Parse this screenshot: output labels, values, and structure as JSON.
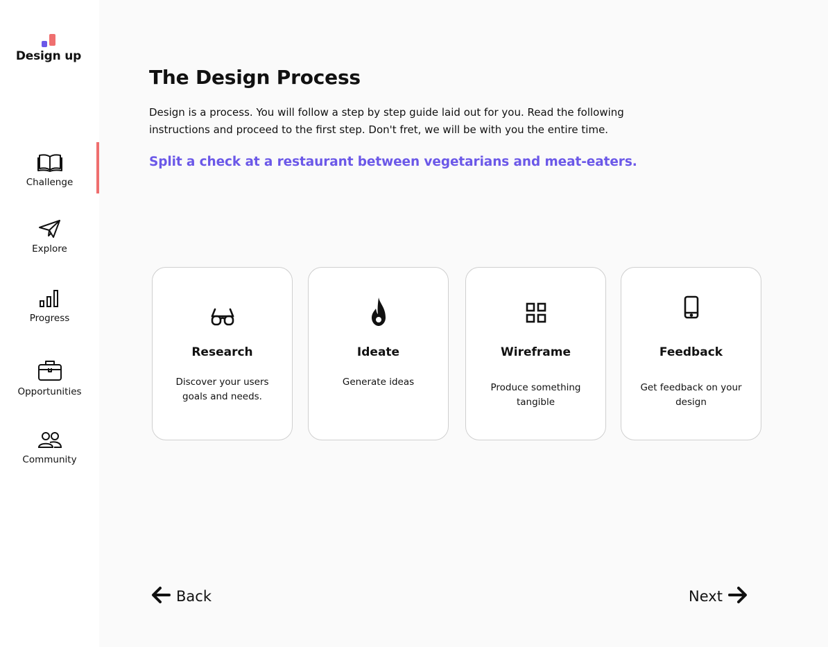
{
  "app": {
    "brand_name": "Design up",
    "brand_colors": {
      "purple": "#6b58e8",
      "coral": "#ef6f6f"
    }
  },
  "sidebar": {
    "items": [
      {
        "label": "Challenge",
        "icon": "book-icon",
        "active": true
      },
      {
        "label": "Explore",
        "icon": "paper-plane-icon",
        "active": false
      },
      {
        "label": "Progress",
        "icon": "bar-chart-icon",
        "active": false
      },
      {
        "label": "Opportunities",
        "icon": "briefcase-icon",
        "active": false
      },
      {
        "label": "Community",
        "icon": "people-icon",
        "active": false
      }
    ]
  },
  "main": {
    "title": "The Design Process",
    "intro": "Design is a process. You will follow a step by step guide laid out for you. Read the following instructions and proceed to the first step. Don't fret, we will be with you the entire time.",
    "challenge": "Split a check at a restaurant between vegetarians and meat-eaters.",
    "steps": [
      {
        "title": "Research",
        "description": "Discover your users goals and needs.",
        "icon": "glasses-icon"
      },
      {
        "title": "Ideate",
        "description": "Generate ideas",
        "icon": "flame-icon"
      },
      {
        "title": "Wireframe",
        "description": "Produce something tangible",
        "icon": "grid-icon"
      },
      {
        "title": "Feedback",
        "description": "Get feedback on your design",
        "icon": "phone-icon"
      }
    ]
  },
  "footer": {
    "back_label": "Back",
    "next_label": "Next"
  }
}
